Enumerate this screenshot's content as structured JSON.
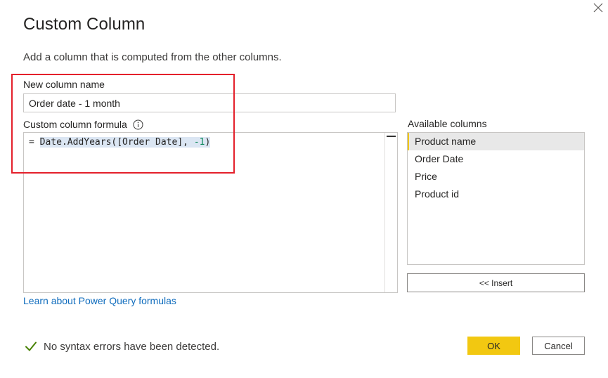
{
  "dialog": {
    "title": "Custom Column",
    "subtitle": "Add a column that is computed from the other columns.",
    "close_icon": "close-icon"
  },
  "new_column": {
    "label": "New column name",
    "value": "Order date - 1 month"
  },
  "formula": {
    "label": "Custom column formula",
    "info_icon": "info-icon",
    "prefix": "= ",
    "expression_main": "Date.AddYears([Order Date], ",
    "expression_number": "-1",
    "expression_end": ")"
  },
  "available_columns": {
    "label": "Available columns",
    "items": [
      "Product name",
      "Order Date",
      "Price",
      "Product id"
    ],
    "selected": "Product name",
    "insert_label": "<< Insert"
  },
  "learn_link": "Learn about Power Query formulas",
  "status": {
    "icon": "checkmark-icon",
    "text": "No syntax errors have been detected.",
    "color": "#498205"
  },
  "buttons": {
    "ok": "OK",
    "cancel": "Cancel"
  },
  "colors": {
    "accent": "#f2c811",
    "link": "#0f6cbd",
    "annotation": "#e4202b"
  }
}
